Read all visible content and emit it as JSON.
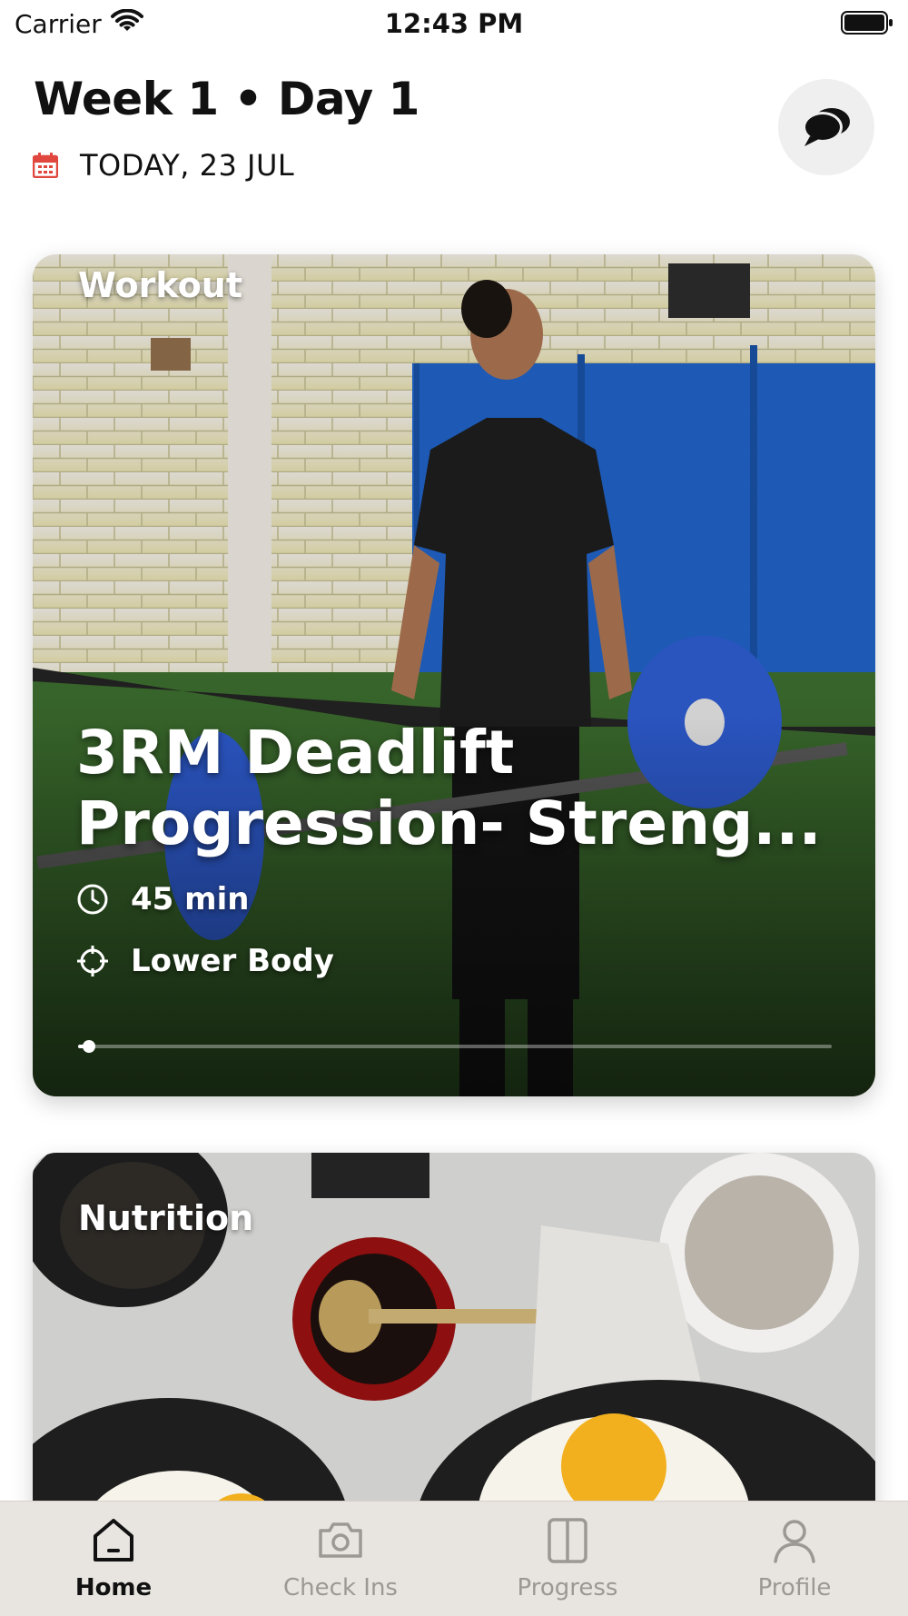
{
  "status_bar": {
    "carrier": "Carrier",
    "time": "12:43 PM"
  },
  "header": {
    "title": "Week 1 • Day 1",
    "date": "TODAY, 23 JUL"
  },
  "workout_card": {
    "label": "Workout",
    "title": "3RM Deadlift Progression- Streng...",
    "duration": "45 min",
    "focus": "Lower Body",
    "progress_fraction": 0.01
  },
  "nutrition_card": {
    "label": "Nutrition"
  },
  "tabs": [
    {
      "label": "Home",
      "icon": "home-icon",
      "active": true
    },
    {
      "label": "Check Ins",
      "icon": "camera-icon",
      "active": false
    },
    {
      "label": "Progress",
      "icon": "compare-icon",
      "active": false
    },
    {
      "label": "Profile",
      "icon": "person-icon",
      "active": false
    }
  ],
  "colors": {
    "calendar_accent": "#e0473f",
    "tab_bar": "#e8e4e0"
  }
}
